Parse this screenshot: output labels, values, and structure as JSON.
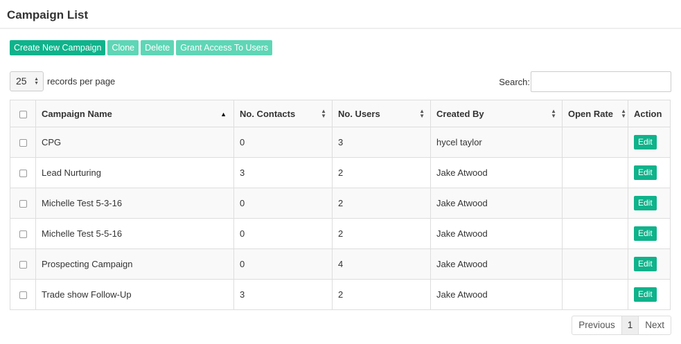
{
  "page": {
    "title": "Campaign List"
  },
  "toolbar": {
    "create_label": "Create New Campaign",
    "clone_label": "Clone",
    "delete_label": "Delete",
    "grant_label": "Grant Access To Users"
  },
  "length": {
    "value": "25",
    "label": "records per page"
  },
  "search": {
    "label": "Search:",
    "value": ""
  },
  "table": {
    "columns": {
      "name": "Campaign Name",
      "contacts": "No. Contacts",
      "users": "No. Users",
      "created_by": "Created By",
      "open_rate": "Open Rate",
      "action": "Action"
    },
    "sorted_column": "name",
    "sort_direction": "asc",
    "edit_label": "Edit",
    "rows": [
      {
        "name": "CPG",
        "contacts": "0",
        "users": "3",
        "created_by": "hycel taylor",
        "open_rate": ""
      },
      {
        "name": "Lead Nurturing",
        "contacts": "3",
        "users": "2",
        "created_by": "Jake Atwood",
        "open_rate": ""
      },
      {
        "name": "Michelle Test 5-3-16",
        "contacts": "0",
        "users": "2",
        "created_by": "Jake Atwood",
        "open_rate": ""
      },
      {
        "name": "Michelle Test 5-5-16",
        "contacts": "0",
        "users": "2",
        "created_by": "Jake Atwood",
        "open_rate": ""
      },
      {
        "name": "Prospecting Campaign",
        "contacts": "0",
        "users": "4",
        "created_by": "Jake Atwood",
        "open_rate": ""
      },
      {
        "name": "Trade show Follow-Up",
        "contacts": "3",
        "users": "2",
        "created_by": "Jake Atwood",
        "open_rate": ""
      }
    ]
  },
  "pagination": {
    "previous": "Previous",
    "current": "1",
    "next": "Next"
  },
  "colors": {
    "accent": "#0fb38b",
    "accent_light": "#5fd6b6"
  }
}
